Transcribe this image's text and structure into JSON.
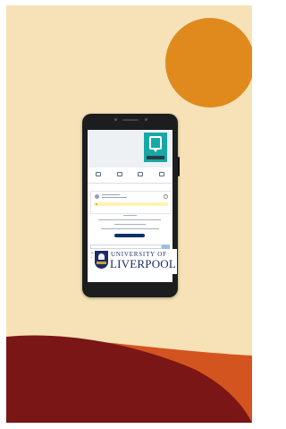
{
  "colors": {
    "background": "#f6e2b6",
    "sun": "#e08a1e",
    "wave_dark": "#7a1616",
    "wave_orange": "#d4541f",
    "teal_logo": "#17a8a6",
    "university_blue": "#1c2b63"
  },
  "university": {
    "line1": "UNIVERSITY OF",
    "line2": "LIVERPOOL"
  },
  "icons": [
    "speech-bubble-logo-icon",
    "university-crest-icon"
  ]
}
